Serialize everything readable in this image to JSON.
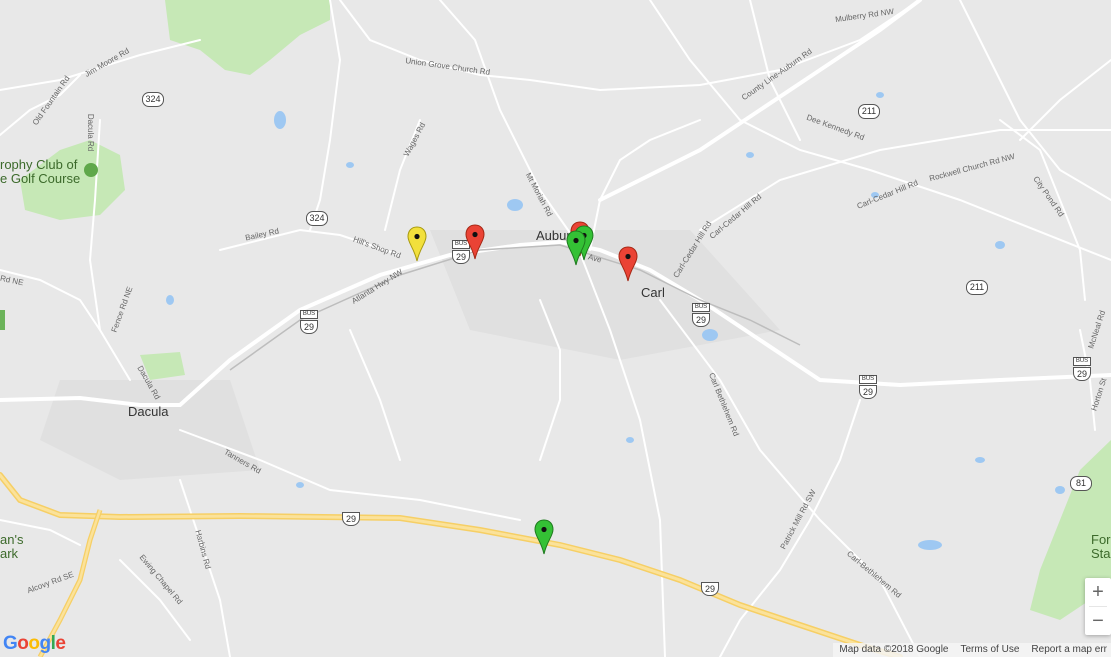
{
  "map": {
    "places": [
      {
        "name": "Auburn"
      },
      {
        "name": "Carl"
      },
      {
        "name": "Dacula"
      }
    ],
    "pois": [
      {
        "name": "rophy Club of",
        "name2": "e Golf Course"
      },
      {
        "name": "an's",
        "name2": "ark"
      },
      {
        "name": "For",
        "name2": "Sta"
      }
    ],
    "roads": [
      "Mulberry Rd NW",
      "County Line-Auburn Rd",
      "Union Grove Church Rd",
      "Jim Moore Rd",
      "Old Fountain Rd",
      "Dacula Rd",
      "Wages Rd",
      "Mt Moriah Rd",
      "Dee Kennedy Rd",
      "Rockwell Church Rd NW",
      "City Pond Rd",
      "Carl-Cedar Hill Rd",
      "Carl-Cedar Hill Rd",
      "Bailey Rd",
      "Hill's Shop Rd",
      "Atlanta Hwy NW",
      "Fence Rd NE",
      "Dacula Rd",
      "Tanners Rd",
      "Harbins Rd",
      "Ewing Chapel Rd",
      "Alcovy Rd SE",
      "Carl Bethlehem Rd",
      "Patrick Mill Rd SW",
      "Carl-Bethlehem Rd",
      "McNeal Rd",
      "Horton St",
      "Ave",
      "Rd NE",
      "Carl-Cedar Hill Rd"
    ],
    "shields": [
      {
        "route": "324"
      },
      {
        "route": "324"
      },
      {
        "route": "211"
      },
      {
        "route": "211"
      },
      {
        "route": "81"
      },
      {
        "route": "29",
        "bus": "BUS"
      },
      {
        "route": "29",
        "bus": "BUS"
      },
      {
        "route": "29",
        "bus": "BUS"
      },
      {
        "route": "29",
        "bus": "BUS"
      },
      {
        "route": "29",
        "bus": "BUS"
      },
      {
        "route": "29"
      },
      {
        "route": "29"
      }
    ],
    "markers": [
      {
        "color": "#f2e03c",
        "stroke": "#a89a10"
      },
      {
        "color": "#ea4335",
        "stroke": "#a52714"
      },
      {
        "color": "#ea4335",
        "stroke": "#a52714"
      },
      {
        "color": "#34c135",
        "stroke": "#1f7a1f"
      },
      {
        "color": "#34c135",
        "stroke": "#1f7a1f"
      },
      {
        "color": "#ea4335",
        "stroke": "#a52714"
      },
      {
        "color": "#34c135",
        "stroke": "#1f7a1f"
      }
    ]
  },
  "controls": {
    "zoom_in": "+",
    "zoom_out": "−"
  },
  "footer": {
    "map_data": "Map data ©2018 Google",
    "terms": "Terms of Use",
    "report": "Report a map err"
  },
  "logo": {
    "letters": [
      "G",
      "o",
      "o",
      "g",
      "l",
      "e"
    ],
    "colors": [
      "#4285f4",
      "#ea4335",
      "#fbbc05",
      "#4285f4",
      "#34a853",
      "#ea4335"
    ]
  }
}
